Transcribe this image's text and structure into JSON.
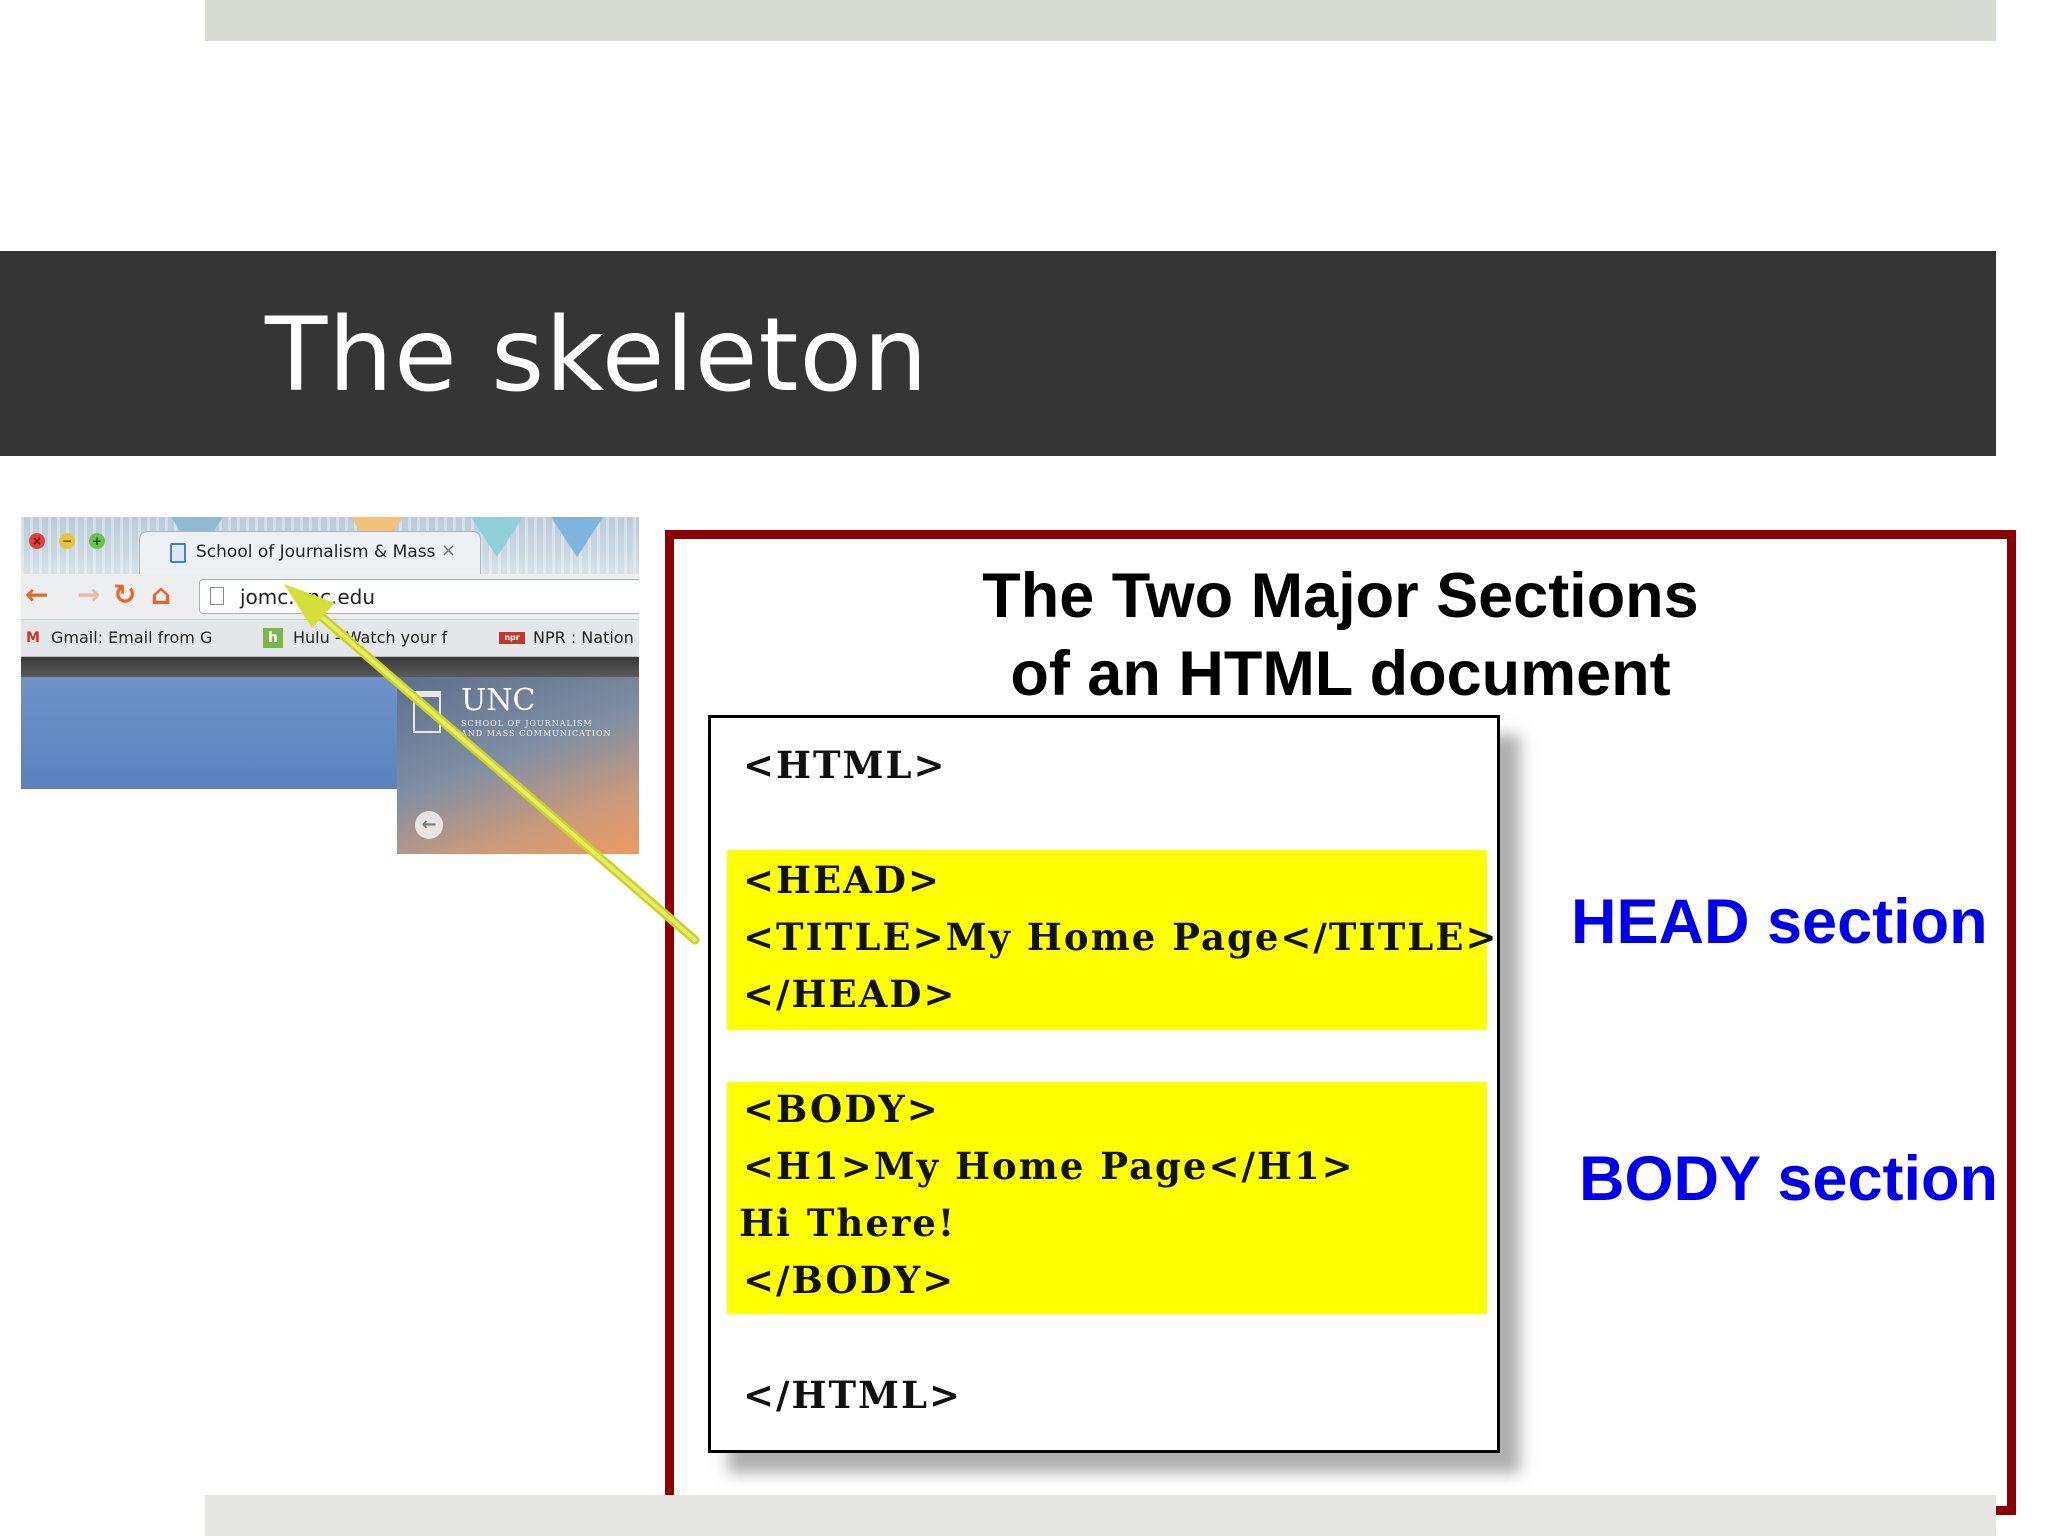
{
  "slide": {
    "title": "The skeleton"
  },
  "browser": {
    "tab_label": "School of Journalism & Mass",
    "tab_close": "×",
    "url": "jomc.unc.edu",
    "bookmarks": [
      "Gmail: Email from G",
      "Hulu - Watch your f",
      "NPR : Nation"
    ],
    "site_name": "UNC",
    "site_subtitle_1": "SCHOOL OF JOURNALISM",
    "site_subtitle_2": "AND MASS COMMUNICATION"
  },
  "diagram": {
    "title_line1": "The Two Major Sections",
    "title_line2": "of an HTML document",
    "code": {
      "html_open": "<HTML>",
      "head_open": "<HEAD>",
      "title_line": "<TITLE>My Home Page</TITLE>",
      "head_close": "</HEAD>",
      "body_open": "<BODY>",
      "h1_line": "<H1>My Home Page</H1>",
      "text_line": "Hi There!",
      "body_close": "</BODY>",
      "html_close": "</HTML>"
    },
    "head_label": "HEAD section",
    "body_label": "BODY section"
  },
  "colors": {
    "title_bar": "#353535",
    "frame": "#8b0000",
    "highlight": "#ffff00",
    "label_blue": "#0000ee",
    "arrow": "#d4e03a"
  }
}
